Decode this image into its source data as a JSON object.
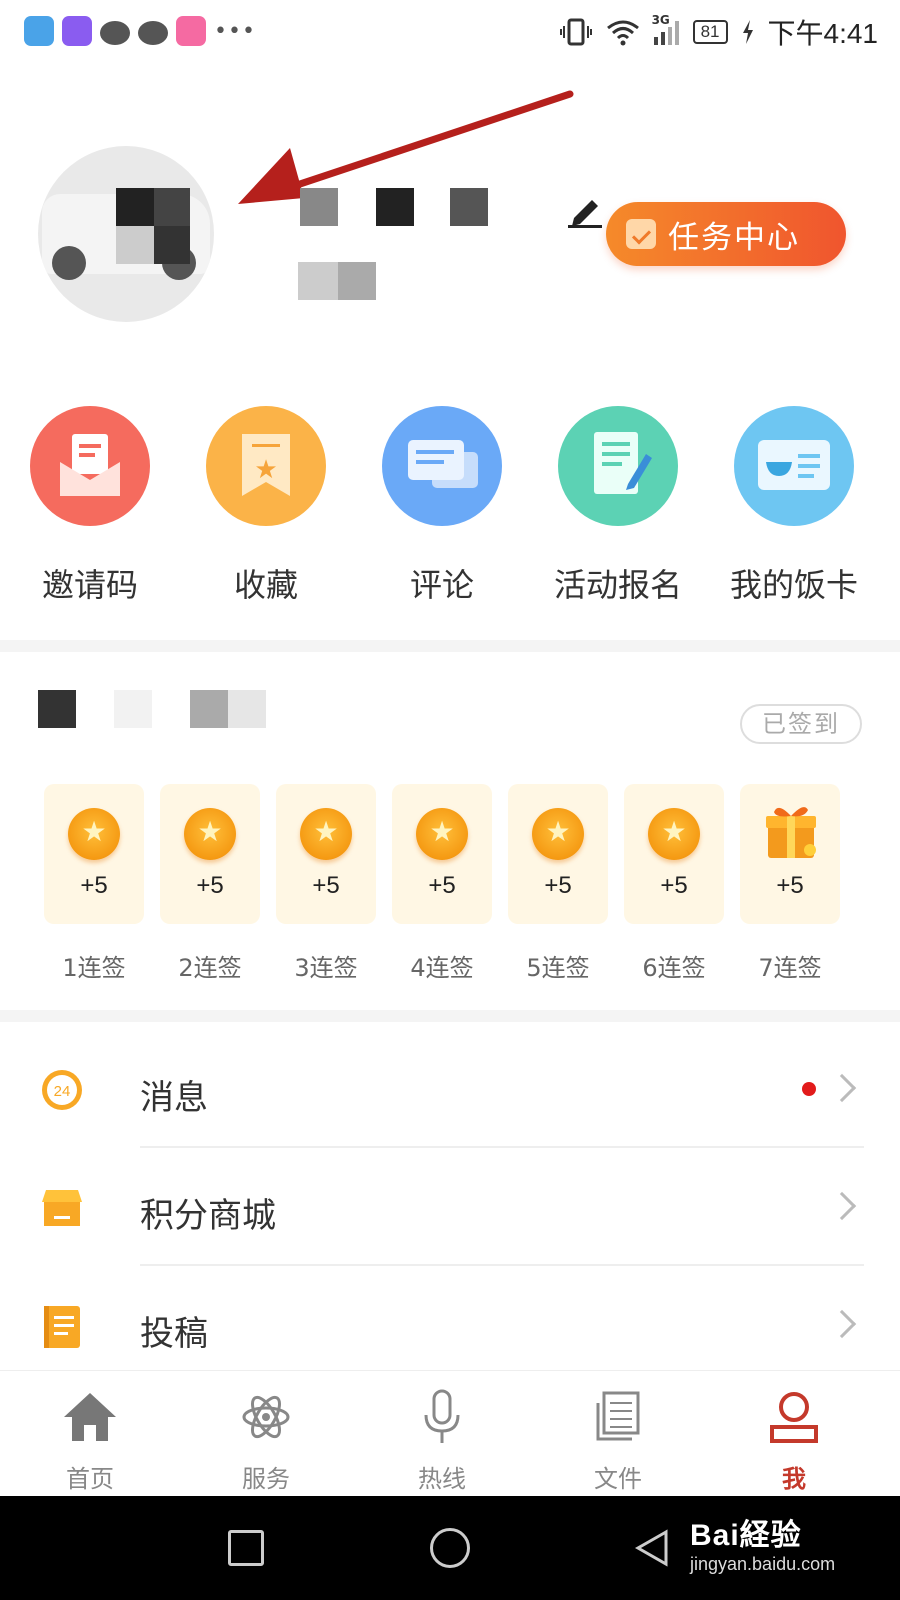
{
  "status_bar": {
    "time": "下午4:41",
    "battery": "81",
    "network": "3G"
  },
  "profile": {
    "task_center_label": "任务中心",
    "accent_color": "#f0552e"
  },
  "shortcuts": [
    {
      "label": "邀请码",
      "icon": "invite-envelope-icon",
      "color": "#f56b5e"
    },
    {
      "label": "收藏",
      "icon": "bookmark-star-icon",
      "color": "#fbb348"
    },
    {
      "label": "评论",
      "icon": "chat-bubbles-icon",
      "color": "#6aa9f7"
    },
    {
      "label": "活动报名",
      "icon": "signup-form-icon",
      "color": "#5cd2b4"
    },
    {
      "label": "我的饭卡",
      "icon": "meal-card-icon",
      "color": "#6ec6f2"
    }
  ],
  "checkin": {
    "status_label": "已签到",
    "days": [
      {
        "points": "+5",
        "label": "1连签",
        "icon": "coin-icon"
      },
      {
        "points": "+5",
        "label": "2连签",
        "icon": "coin-icon"
      },
      {
        "points": "+5",
        "label": "3连签",
        "icon": "coin-icon"
      },
      {
        "points": "+5",
        "label": "4连签",
        "icon": "coin-icon"
      },
      {
        "points": "+5",
        "label": "5连签",
        "icon": "coin-icon"
      },
      {
        "points": "+5",
        "label": "6连签",
        "icon": "coin-icon"
      },
      {
        "points": "+5",
        "label": "7连签",
        "icon": "gift-icon"
      }
    ]
  },
  "menu": [
    {
      "label": "消息",
      "icon": "clock-24-icon",
      "badge": "unread-dot"
    },
    {
      "label": "积分商城",
      "icon": "store-icon"
    },
    {
      "label": "投稿",
      "icon": "document-icon"
    }
  ],
  "tabbar": [
    {
      "label": "首页",
      "icon": "home-icon"
    },
    {
      "label": "服务",
      "icon": "atom-icon"
    },
    {
      "label": "热线",
      "icon": "microphone-icon"
    },
    {
      "label": "文件",
      "icon": "files-icon"
    },
    {
      "label": "我",
      "icon": "user-icon",
      "active": true
    }
  ],
  "watermark": {
    "main": "Bai経验",
    "sub": "jingyan.baidu.com"
  }
}
